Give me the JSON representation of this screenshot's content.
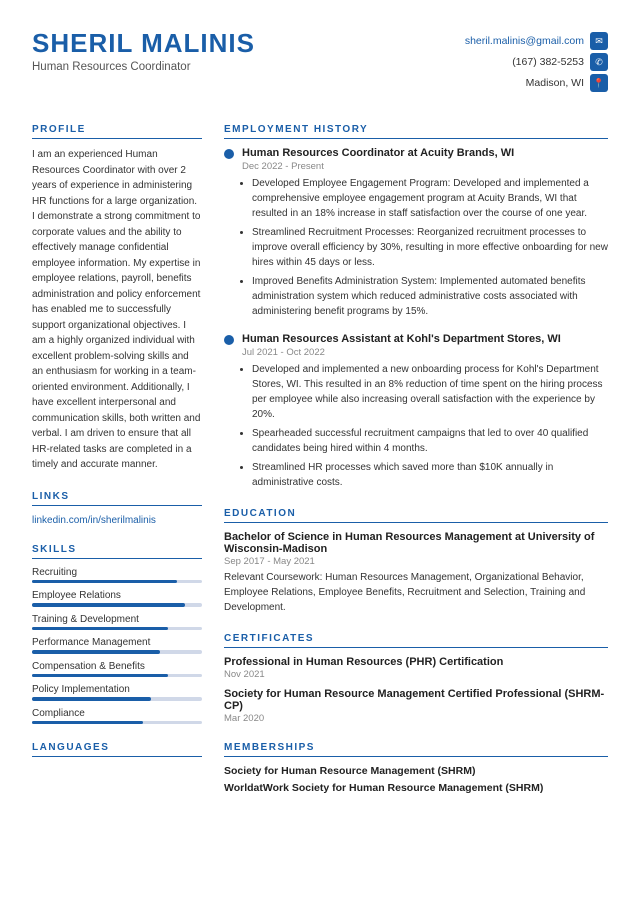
{
  "header": {
    "name": "SHERIL MALINIS",
    "title": "Human Resources Coordinator",
    "email": "sheril.malinis@gmail.com",
    "phone": "(167) 382-5253",
    "location": "Madison, WI"
  },
  "profile": {
    "section_label": "PROFILE",
    "text": "I am an experienced Human Resources Coordinator with over 2 years of experience in administering HR functions for a large organization. I demonstrate a strong commitment to corporate values and the ability to effectively manage confidential employee information. My expertise in employee relations, payroll, benefits administration and policy enforcement has enabled me to successfully support organizational objectives. I am a highly organized individual with excellent problem-solving skills and an enthusiasm for working in a team-oriented environment. Additionally, I have excellent interpersonal and communication skills, both written and verbal. I am driven to ensure that all HR-related tasks are completed in a timely and accurate manner."
  },
  "links": {
    "section_label": "LINKS",
    "items": [
      {
        "label": "linkedin.com/in/sherilmalinis",
        "url": "#"
      }
    ]
  },
  "skills": {
    "section_label": "SKILLS",
    "items": [
      {
        "label": "Recruiting",
        "pct": 85
      },
      {
        "label": "Employee Relations",
        "pct": 90
      },
      {
        "label": "Training & Development",
        "pct": 80
      },
      {
        "label": "Performance Management",
        "pct": 75
      },
      {
        "label": "Compensation & Benefits",
        "pct": 80
      },
      {
        "label": "Policy Implementation",
        "pct": 70
      },
      {
        "label": "Compliance",
        "pct": 65
      }
    ]
  },
  "languages": {
    "section_label": "LANGUAGES"
  },
  "employment": {
    "section_label": "EMPLOYMENT HISTORY",
    "jobs": [
      {
        "title": "Human Resources Coordinator at Acuity Brands, WI",
        "dates": "Dec 2022 - Present",
        "bullets": [
          "Developed Employee Engagement Program: Developed and implemented a comprehensive employee engagement program at Acuity Brands, WI that resulted in an 18% increase in staff satisfaction over the course of one year.",
          "Streamlined Recruitment Processes: Reorganized recruitment processes to improve overall efficiency by 30%, resulting in more effective onboarding for new hires within 45 days or less.",
          "Improved Benefits Administration System: Implemented automated benefits administration system which reduced administrative costs associated with administering benefit programs by 15%."
        ]
      },
      {
        "title": "Human Resources Assistant at Kohl's Department Stores, WI",
        "dates": "Jul 2021 - Oct 2022",
        "bullets": [
          "Developed and implemented a new onboarding process for Kohl's Department Stores, WI. This resulted in an 8% reduction of time spent on the hiring process per employee while also increasing overall satisfaction with the experience by 20%.",
          "Spearheaded successful recruitment campaigns that led to over 40 qualified candidates being hired within 4 months.",
          "Streamlined HR processes which saved more than $10K annually in administrative costs."
        ]
      }
    ]
  },
  "education": {
    "section_label": "EDUCATION",
    "title": "Bachelor of Science in Human Resources Management at University of Wisconsin-Madison",
    "dates": "Sep 2017 - May 2021",
    "text": "Relevant Coursework: Human Resources Management, Organizational Behavior, Employee Relations, Employee Benefits, Recruitment and Selection, Training and Development."
  },
  "certificates": {
    "section_label": "CERTIFICATES",
    "items": [
      {
        "title": "Professional in Human Resources (PHR) Certification",
        "date": "Nov 2021"
      },
      {
        "title": "Society for Human Resource Management Certified Professional (SHRM-CP)",
        "date": "Mar 2020"
      }
    ]
  },
  "memberships": {
    "section_label": "MEMBERSHIPS",
    "items": [
      "Society for Human Resource Management (SHRM)",
      "WorldatWork Society for Human Resource Management (SHRM)"
    ]
  }
}
